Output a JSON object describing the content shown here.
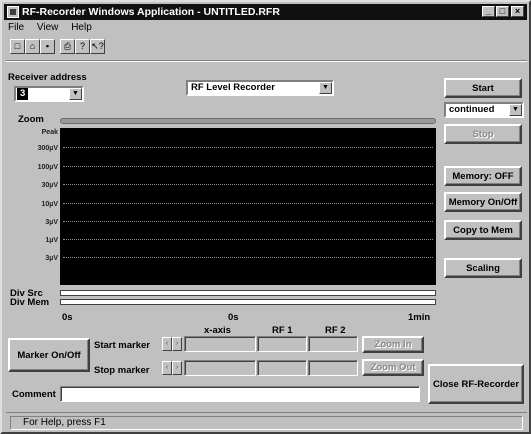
{
  "window": {
    "title": "RF-Recorder Windows Application - UNTITLED.RFR",
    "min_glyph": "_",
    "max_glyph": "□",
    "close_glyph": "×"
  },
  "menu": [
    "File",
    "View",
    "Help"
  ],
  "toolbar": [
    {
      "icon": "new-file-icon",
      "glyph": "□"
    },
    {
      "icon": "open-folder-icon",
      "glyph": "⌂"
    },
    {
      "icon": "save-icon",
      "glyph": "▪"
    },
    {
      "icon": "print-icon",
      "glyph": "⎙"
    },
    {
      "icon": "about-icon",
      "glyph": "?"
    },
    {
      "icon": "context-help-icon",
      "glyph": "↖?"
    }
  ],
  "receiver": {
    "label": "Receiver address",
    "value": "3"
  },
  "mode": {
    "value": "RF Level Recorder"
  },
  "zoom": {
    "label": "Zoom"
  },
  "plot": {
    "y_labels": [
      "Peak",
      "300µV",
      "100µV",
      "30µV",
      "10µV",
      "3µV",
      "1µV",
      "3µV"
    ],
    "x_left": "0s",
    "x_mid": "0s",
    "x_right": "1min"
  },
  "div_src_label": "Div Src",
  "div_mem_label": "Div Mem",
  "controls": {
    "start": "Start",
    "run_mode": "continued",
    "stop": "Stop",
    "memory_status": "Memory: OFF",
    "memory_toggle": "Memory On/Off",
    "copy_to_mem": "Copy to Mem",
    "scaling": "Scaling",
    "close": "Close RF-Recorder"
  },
  "markers": {
    "toggle": "Marker On/Off",
    "start_label": "Start marker",
    "stop_label": "Stop marker",
    "col_x": "x-axis",
    "col_rf1": "RF 1",
    "col_rf2": "RF 2",
    "zoom_in": "Zoom In",
    "zoom_out": "Zoom Out",
    "spin_left": "‹",
    "spin_right": "›"
  },
  "comment": {
    "label": "Comment",
    "value": ""
  },
  "status": {
    "text": "For Help, press F1"
  }
}
